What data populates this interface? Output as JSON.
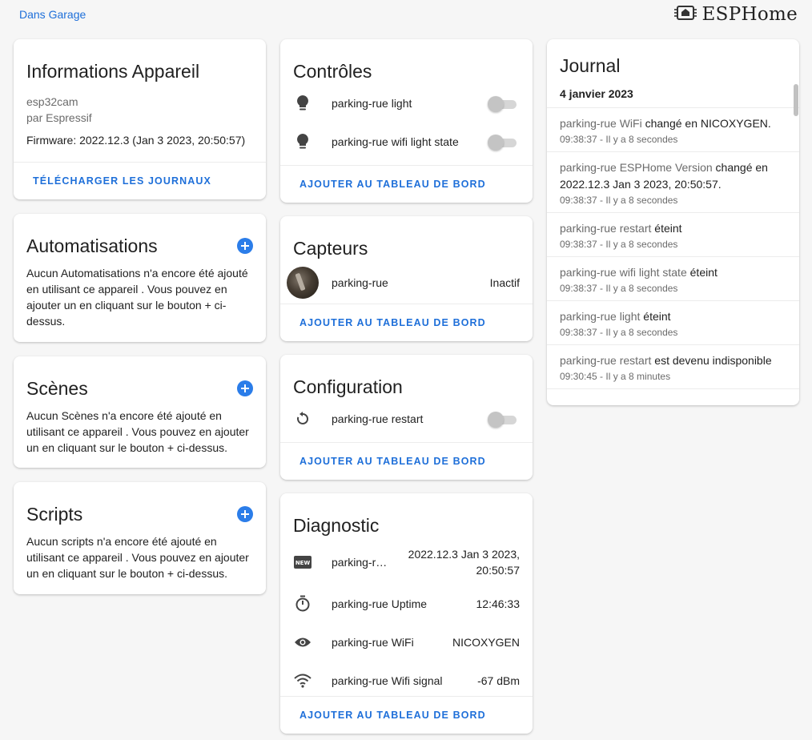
{
  "breadcrumb": "Dans Garage",
  "brand": {
    "name": "ESPHome",
    "logo_icon": "esphome-chip-icon"
  },
  "device_info": {
    "title": "Informations Appareil",
    "model": "esp32cam",
    "manufacturer": "par Espressif",
    "firmware": "Firmware: 2022.12.3 (Jan 3 2023, 20:50:57)",
    "action": "Télécharger les journaux"
  },
  "automations": {
    "title": "Automatisations",
    "description": "Aucun Automatisations n'a encore été ajouté en utilisant ce appareil . Vous pouvez en ajouter un en cliquant sur le bouton + ci-dessus."
  },
  "scenes": {
    "title": "Scènes",
    "description": "Aucun Scènes n'a encore été ajouté en utilisant ce appareil . Vous pouvez en ajouter un en cliquant sur le bouton + ci-dessus."
  },
  "scripts": {
    "title": "Scripts",
    "description": "Aucun scripts n'a encore été ajouté en utilisant ce appareil . Vous pouvez en ajouter un en cliquant sur le bouton + ci-dessus."
  },
  "controls": {
    "title": "Contrôles",
    "items": [
      {
        "label": "parking-rue light",
        "icon": "lightbulb-icon",
        "state": "off"
      },
      {
        "label": "parking-rue wifi light state",
        "icon": "lightbulb-icon",
        "state": "off"
      }
    ],
    "action": "Ajouter au tableau de bord"
  },
  "sensors": {
    "title": "Capteurs",
    "items": [
      {
        "label": "parking-rue",
        "value": "Inactif",
        "icon": "camera-thumbnail"
      }
    ],
    "action": "Ajouter au tableau de bord"
  },
  "configuration": {
    "title": "Configuration",
    "items": [
      {
        "label": "parking-rue restart",
        "icon": "restart-icon",
        "state": "off"
      }
    ],
    "action": "Ajouter au tableau de bord"
  },
  "diagnostic": {
    "title": "Diagnostic",
    "items": [
      {
        "label": "parking-r…",
        "value_line1": "2022.12.3 Jan 3 2023,",
        "value_line2": "20:50:57",
        "icon": "new-box-icon"
      },
      {
        "label": "parking-rue Uptime",
        "value": "12:46:33",
        "icon": "timer-icon"
      },
      {
        "label": "parking-rue WiFi",
        "value": "NICOXYGEN",
        "icon": "eye-icon"
      },
      {
        "label": "parking-rue Wifi signal",
        "value": "-67 dBm",
        "icon": "wifi-icon"
      }
    ],
    "action": "Ajouter au tableau de bord"
  },
  "journal": {
    "title": "Journal",
    "date": "4 janvier 2023",
    "entries": [
      {
        "entity": "parking-rue WiFi",
        "message": " changé en NICOXYGEN.",
        "time": "09:38:37 - Il y a 8 secondes"
      },
      {
        "entity": "parking-rue ESPHome Version",
        "message": " changé en 2022.12.3 Jan 3 2023, 20:50:57.",
        "time": "09:38:37 - Il y a 8 secondes"
      },
      {
        "entity": "parking-rue restart",
        "message": " éteint",
        "time": "09:38:37 - Il y a 8 secondes"
      },
      {
        "entity": "parking-rue wifi light state",
        "message": " éteint",
        "time": "09:38:37 - Il y a 8 secondes"
      },
      {
        "entity": "parking-rue light",
        "message": " éteint",
        "time": "09:38:37 - Il y a 8 secondes"
      },
      {
        "entity": "parking-rue restart",
        "message": " est devenu indisponible",
        "time": "09:30:45 - Il y a 8 minutes"
      }
    ]
  },
  "colors": {
    "accent": "#1e6fd9",
    "add_button": "#2b7de9",
    "background": "#f6f6f6"
  }
}
